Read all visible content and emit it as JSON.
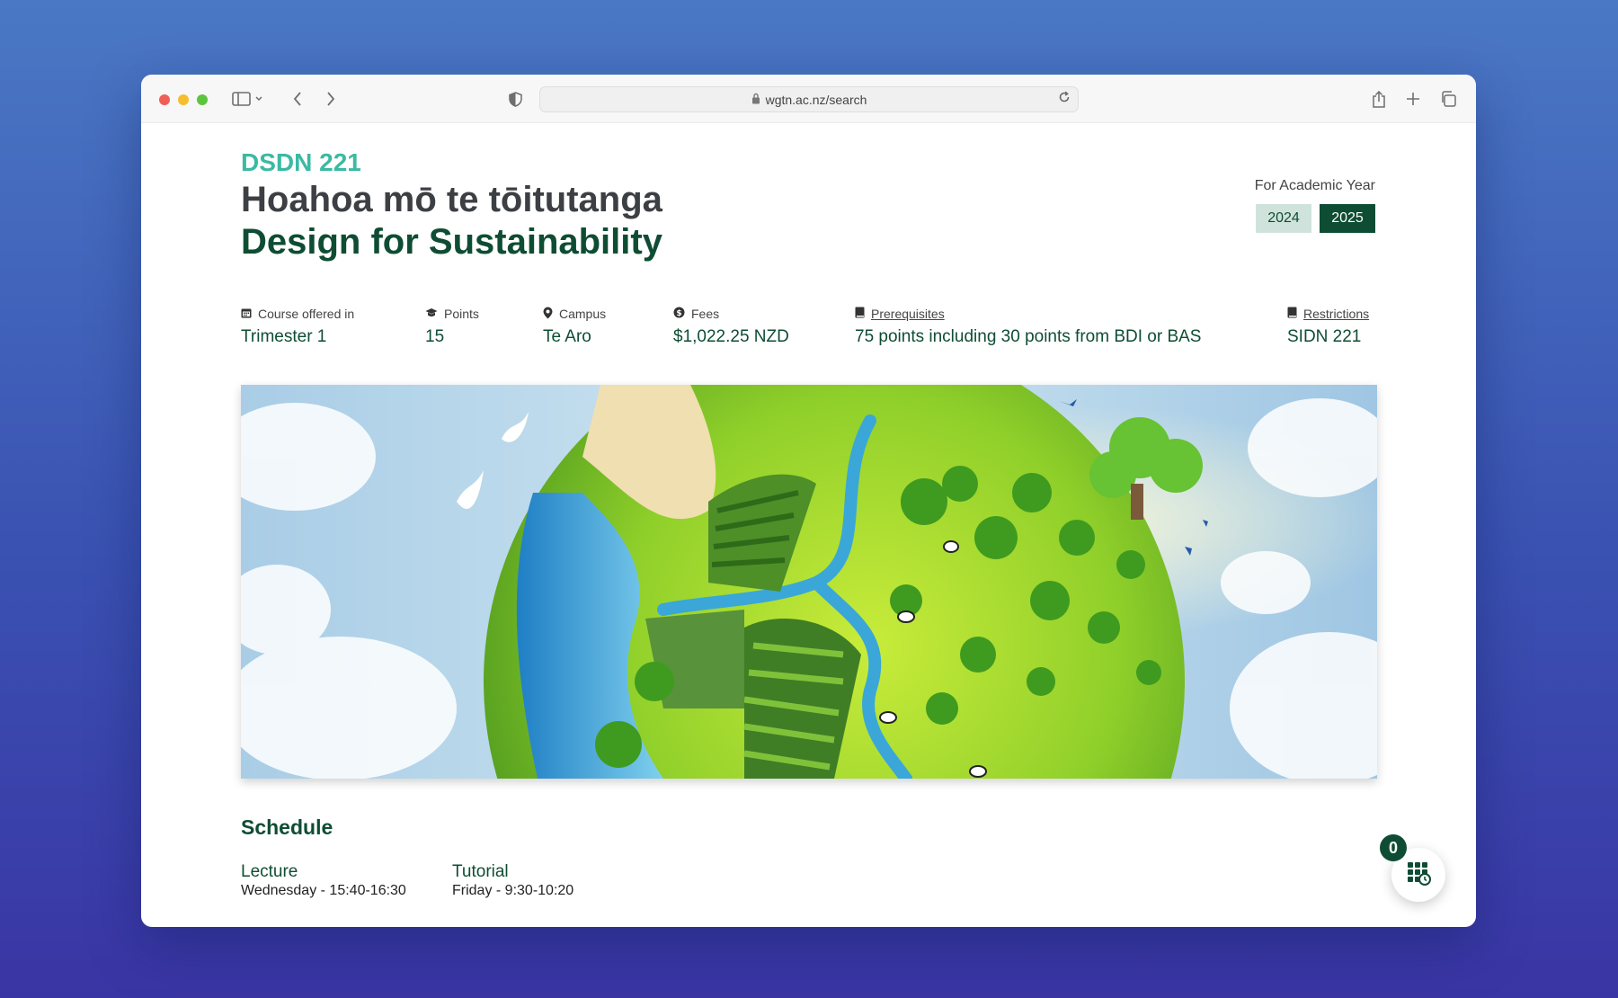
{
  "browser": {
    "url": "wgtn.ac.nz/search"
  },
  "course": {
    "code": "DSDN 221",
    "title_maori": "Hoahoa mō te tōitutanga",
    "title_english": "Design for Sustainability"
  },
  "academic_year": {
    "label": "For Academic Year",
    "options": [
      "2024",
      "2025"
    ],
    "selected": "2025"
  },
  "info": {
    "offered": {
      "label": "Course offered in",
      "value": "Trimester 1",
      "icon": "calendar-icon"
    },
    "points": {
      "label": "Points",
      "value": "15",
      "icon": "graduation-cap-icon"
    },
    "campus": {
      "label": "Campus",
      "value": "Te Aro",
      "icon": "map-pin-icon"
    },
    "fees": {
      "label": "Fees",
      "value": "$1,022.25 NZD",
      "icon": "dollar-circle-icon"
    },
    "prerequisites": {
      "label": "Prerequisites",
      "value": "75 points including 30 points from BDI or BAS",
      "icon": "book-icon"
    },
    "restrictions": {
      "label": "Restrictions",
      "value": "SIDN 221",
      "icon": "book-icon"
    }
  },
  "hero": {
    "icon": "earth-globe-illustration"
  },
  "schedule": {
    "title": "Schedule",
    "items": [
      {
        "type": "Lecture",
        "time": "Wednesday - 15:40-16:30"
      },
      {
        "type": "Tutorial",
        "time": "Friday - 9:30-10:20"
      }
    ]
  },
  "timetable_fab": {
    "count": "0",
    "icon": "timetable-grid-icon"
  },
  "colors": {
    "accent_teal": "#3bbaa2",
    "brand_green": "#0e4d33",
    "year_inactive_bg": "#cfe3dc"
  }
}
